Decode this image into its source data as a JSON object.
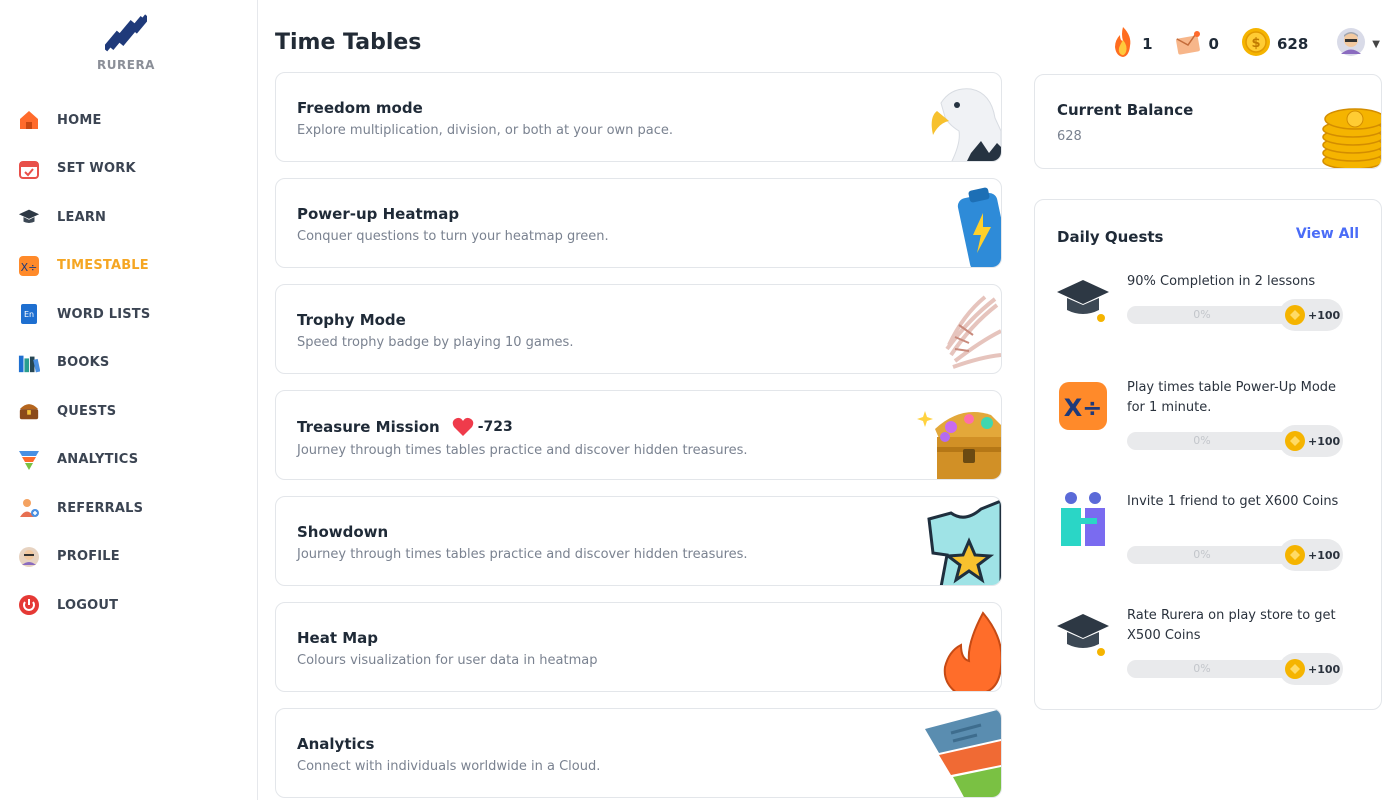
{
  "brand": {
    "name": "RURERA"
  },
  "sidebar": {
    "items": [
      {
        "label": "HOME",
        "icon": "home-icon",
        "active": false
      },
      {
        "label": "SET WORK",
        "icon": "calendar-icon",
        "active": false
      },
      {
        "label": "LEARN",
        "icon": "graduation-cap-icon",
        "active": false
      },
      {
        "label": "TIMESTABLE",
        "icon": "calculator-icon",
        "active": true
      },
      {
        "label": "WORD LISTS",
        "icon": "dictionary-icon",
        "active": false
      },
      {
        "label": "BOOKS",
        "icon": "books-icon",
        "active": false
      },
      {
        "label": "QUESTS",
        "icon": "treasure-chest-icon",
        "active": false
      },
      {
        "label": "ANALYTICS",
        "icon": "funnel-icon",
        "active": false
      },
      {
        "label": "REFERRALS",
        "icon": "user-add-icon",
        "active": false
      },
      {
        "label": "PROFILE",
        "icon": "avatar-icon",
        "active": false
      },
      {
        "label": "LOGOUT",
        "icon": "power-icon",
        "active": false
      }
    ]
  },
  "header": {
    "title": "Time Tables",
    "streak": "1",
    "messages": "0",
    "coins": "628"
  },
  "cards": [
    {
      "title": "Freedom mode",
      "desc": "Explore multiplication, division, or both at your own pace.",
      "art": "eagle-icon"
    },
    {
      "title": "Power-up Heatmap",
      "desc": "Conquer questions to turn your heatmap green.",
      "art": "battery-icon"
    },
    {
      "title": "Trophy Mode",
      "desc": "Speed trophy badge by playing 10 games.",
      "art": "fan-icon"
    },
    {
      "title": "Treasure Mission",
      "desc": "Journey through times tables practice and discover hidden treasures.",
      "art": "treasure-chest-icon",
      "hearts": "-723"
    },
    {
      "title": "Showdown",
      "desc": "Journey through times tables practice and discover hidden treasures.",
      "art": "star-shirt-icon"
    },
    {
      "title": "Heat Map",
      "desc": "Colours visualization for user data in heatmap",
      "art": "flame-icon"
    },
    {
      "title": "Analytics",
      "desc": "Connect with individuals worldwide in a Cloud.",
      "art": "funnel-icon"
    }
  ],
  "balance": {
    "title": "Current Balance",
    "value": "628"
  },
  "quests": {
    "title": "Daily Quests",
    "view_all": "View All",
    "items": [
      {
        "text": "90% Completion in 2 lessons",
        "progress": "0%",
        "progress_value": 0,
        "reward": "+100",
        "icon": "graduation-cap-icon"
      },
      {
        "text": "Play times table Power-Up Mode for 1 minute.",
        "progress": "0%",
        "progress_value": 0,
        "reward": "+100",
        "icon": "calculator-icon"
      },
      {
        "text": "Invite 1 friend to get X600 Coins",
        "progress": "0%",
        "progress_value": 0,
        "reward": "+100",
        "icon": "friends-icon"
      },
      {
        "text": "Rate Rurera on play store to get X500 Coins",
        "progress": "0%",
        "progress_value": 0,
        "reward": "+100",
        "icon": "graduation-cap-icon"
      }
    ]
  },
  "colors": {
    "accent": "#f5a623",
    "link": "#4a6cf7",
    "coin": "#f5b400"
  }
}
